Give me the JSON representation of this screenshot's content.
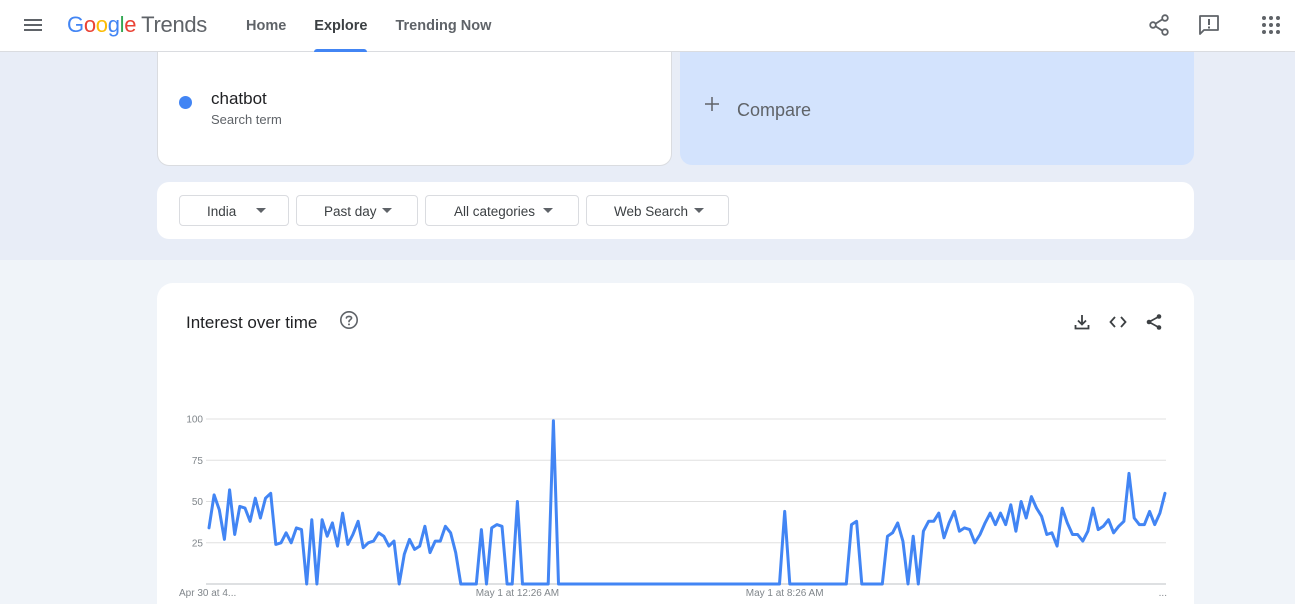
{
  "header": {
    "logo_letters": [
      "G",
      "o",
      "o",
      "g",
      "l",
      "e"
    ],
    "logo_product": "Trends",
    "nav": [
      {
        "label": "Home",
        "active": false
      },
      {
        "label": "Explore",
        "active": true
      },
      {
        "label": "Trending Now",
        "active": false
      }
    ],
    "icons": [
      "menu-icon",
      "share-icon",
      "feedback-icon",
      "apps-icon"
    ]
  },
  "search_term": {
    "name": "chatbot",
    "subtitle": "Search term",
    "color": "#4285f4"
  },
  "compare": {
    "label": "Compare"
  },
  "filters": {
    "region": "India",
    "time_range": "Past day",
    "category": "All categories",
    "search_type": "Web Search"
  },
  "chart_card": {
    "title": "Interest over time",
    "actions": [
      "download-icon",
      "embed-icon",
      "share-icon"
    ]
  },
  "chart_data": {
    "type": "line",
    "title": "Interest over time",
    "series": [
      {
        "color": "#4285f4",
        "values": [
          34,
          54,
          45,
          27,
          57,
          30,
          47,
          46,
          38,
          52,
          40,
          52,
          55,
          24,
          25,
          31,
          25,
          34,
          33,
          0,
          39,
          0,
          39,
          29,
          37,
          23,
          43,
          24,
          30,
          38,
          22,
          25,
          26,
          31,
          29,
          23,
          26,
          0,
          18,
          27,
          21,
          23,
          35,
          19,
          26,
          26,
          35,
          31,
          19,
          0,
          0,
          0,
          0,
          33,
          0,
          34,
          36,
          35,
          0,
          0,
          50,
          0,
          0,
          0,
          0,
          0,
          0,
          99,
          0,
          0,
          0,
          0,
          0,
          0,
          0,
          0,
          0,
          0,
          0,
          0,
          0,
          0,
          0,
          0,
          0,
          0,
          0,
          0,
          0,
          0,
          0,
          0,
          0,
          0,
          0,
          0,
          0,
          0,
          0,
          0,
          0,
          0,
          0,
          0,
          0,
          0,
          0,
          0,
          0,
          0,
          0,
          0,
          44,
          0,
          0,
          0,
          0,
          0,
          0,
          0,
          0,
          0,
          0,
          0,
          0,
          36,
          38,
          0,
          0,
          0,
          0,
          0,
          29,
          31,
          37,
          26,
          0,
          29,
          0,
          32,
          38,
          38,
          43,
          28,
          37,
          44,
          32,
          34,
          33,
          25,
          30,
          37,
          43,
          36,
          43,
          36,
          48,
          32,
          50,
          40,
          53,
          46,
          41,
          30,
          31,
          23,
          46,
          37,
          30,
          30,
          26,
          32,
          46,
          33,
          35,
          39,
          31,
          35,
          38,
          67,
          40,
          36,
          36,
          44,
          36,
          43,
          55
        ]
      }
    ],
    "ylim": [
      0,
      100
    ],
    "yticks": [
      25,
      50,
      75,
      100
    ],
    "xtick_labels": [
      "Apr 30 at 4...",
      "May 1 at 12:26 AM",
      "May 1 at 8:26 AM",
      "..."
    ],
    "xtick_positions": [
      0,
      60,
      112,
      157
    ],
    "grid": true
  }
}
